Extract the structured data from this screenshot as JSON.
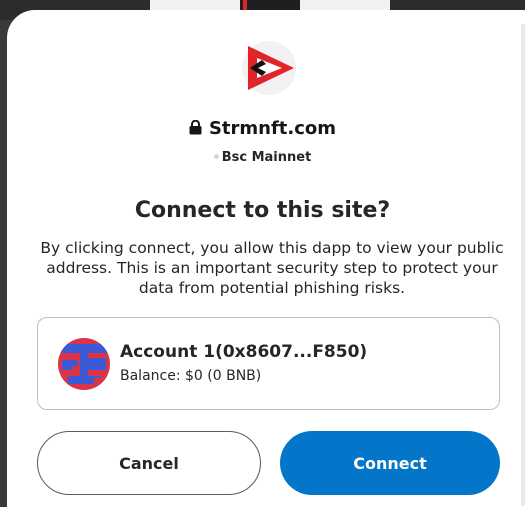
{
  "site": {
    "name": "Strmnft.com",
    "network": "Bsc Mainnet"
  },
  "prompt": {
    "title": "Connect to this site?",
    "description": "By clicking connect, you allow this dapp to view your public address. This is an important security step to protect your data from potential phishing risks."
  },
  "account": {
    "name": "Account 1(0x8607...F850)",
    "balance": "Balance: $0 (0 BNB)"
  },
  "buttons": {
    "cancel": "Cancel",
    "connect": "Connect"
  },
  "colors": {
    "primary": "#0376c9",
    "text": "#24272a",
    "border": "#bbc0c5",
    "logo_red": "#e0242a"
  },
  "icons": {
    "site_logo": "play-logo-icon",
    "lock": "lock-icon",
    "network_dot": "network-status-dot",
    "avatar": "identicon-avatar"
  }
}
